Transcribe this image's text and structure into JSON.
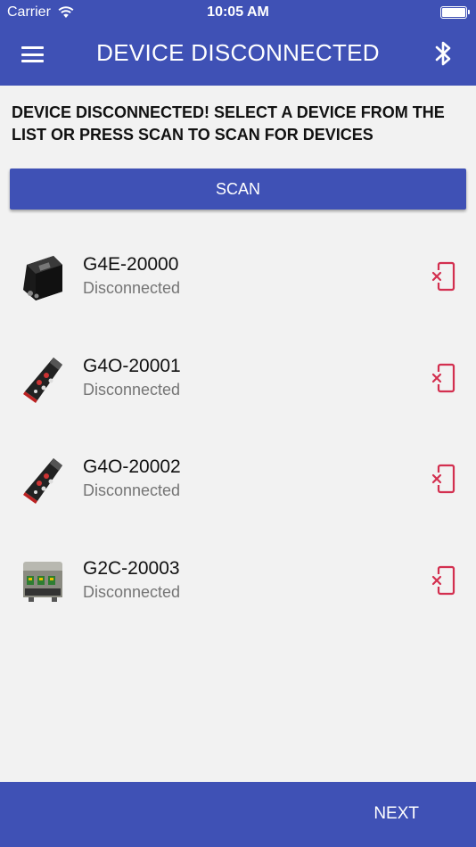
{
  "status_bar": {
    "carrier": "Carrier",
    "time": "10:05 AM",
    "icons": [
      "wifi-icon",
      "battery-icon"
    ]
  },
  "header": {
    "title": "DEVICE DISCONNECTED",
    "left_icon": "menu-icon",
    "right_icon": "bluetooth-icon"
  },
  "instructions": "DEVICE DISCONNECTED! SELECT A DEVICE FROM THE LIST OR PRESS SCAN TO SCAN FOR DEVICES",
  "scan_button": "SCAN",
  "devices": [
    {
      "name": "G4E-20000",
      "status": "Disconnected",
      "image": "black-box-device",
      "action_icon": "disconnected-phone-icon"
    },
    {
      "name": "G4O-20001",
      "status": "Disconnected",
      "image": "handheld-remote-device",
      "action_icon": "disconnected-phone-icon"
    },
    {
      "name": "G4O-20002",
      "status": "Disconnected",
      "image": "handheld-remote-device",
      "action_icon": "disconnected-phone-icon"
    },
    {
      "name": "G2C-20003",
      "status": "Disconnected",
      "image": "circuit-board-device",
      "action_icon": "disconnected-phone-icon"
    }
  ],
  "footer": {
    "next_button": "NEXT"
  },
  "colors": {
    "primary": "#3f51b5",
    "background": "#f2f2f2",
    "status_text": "#757575",
    "disconnect_icon": "#d32f4f"
  }
}
